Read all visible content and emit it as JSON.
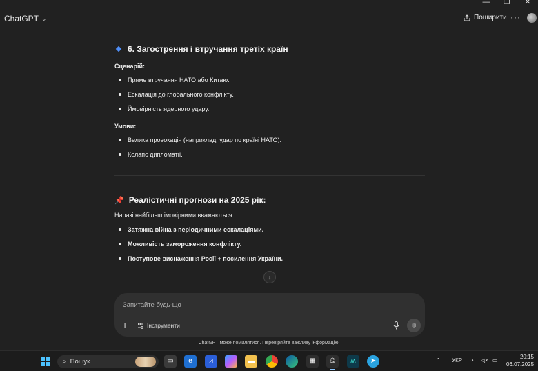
{
  "window": {
    "minimize": "—",
    "restore": "❐",
    "close": "✕"
  },
  "header": {
    "app_name": "ChatGPT",
    "share_label": "Поширити",
    "more": "···"
  },
  "section6": {
    "title": "6. Загострення і втручання третіх країн",
    "scenario_label": "Сценарій:",
    "scenario_items": [
      "Пряме втручання НАТО або Китаю.",
      "Ескалація до глобального конфлікту.",
      "Ймовірність ядерного удару."
    ],
    "conditions_label": "Умови:",
    "conditions_items": [
      "Велика провокація (наприклад, удар по країні НАТО).",
      "Колапс дипломатії."
    ]
  },
  "forecast": {
    "pin": "📌",
    "title": "Реалістичні прогнози на 2025 рік:",
    "intro": "Наразі найбільш імовірними вважаються:",
    "items": [
      "Затяжна війна з періодичними ескалаціями.",
      "Можливість замороження конфлікту.",
      "Поступове виснаження Росії + посилення України."
    ]
  },
  "composer": {
    "placeholder": "Запитайте будь-що",
    "tools_label": "Інструменти"
  },
  "footer": {
    "disclaimer": "ChatGPT може помилятися. Перевіряйте важливу інформацію."
  },
  "taskbar": {
    "search_label": "Пошук",
    "language": "УКР",
    "time": "20:15",
    "date": "06.07.2025",
    "apps": [
      "task-view",
      "edge-beta",
      "app-store-blue",
      "copilot",
      "file-explorer",
      "chrome",
      "edge",
      "microsoft-store",
      "chatgpt",
      "neural-app",
      "telegram"
    ]
  },
  "colors": {
    "background": "#212121",
    "composer": "#303030",
    "accent_blue": "#4f8ef7",
    "taskbar": "#1c1c1c"
  }
}
